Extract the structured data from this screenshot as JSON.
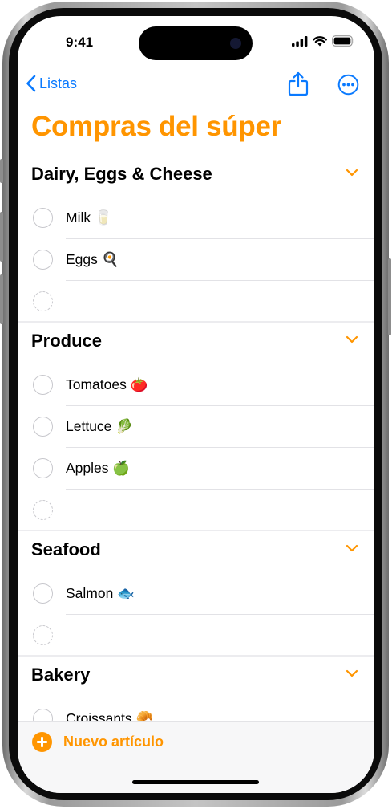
{
  "status_bar": {
    "time": "9:41"
  },
  "nav": {
    "back_label": "Listas"
  },
  "list_title": "Compras del súper",
  "colors": {
    "accent": "#ff9500",
    "link": "#0a7aff"
  },
  "sections": [
    {
      "title": "Dairy, Eggs & Cheese",
      "items": [
        "Milk 🥛",
        "Eggs 🍳"
      ]
    },
    {
      "title": "Produce",
      "items": [
        "Tomatoes 🍅",
        "Lettuce 🥬",
        "Apples 🍏"
      ]
    },
    {
      "title": "Seafood",
      "items": [
        "Salmon 🐟"
      ]
    },
    {
      "title": "Bakery",
      "items": [
        "Croissants 🥐"
      ]
    }
  ],
  "toolbar": {
    "new_item_label": "Nuevo artículo"
  }
}
